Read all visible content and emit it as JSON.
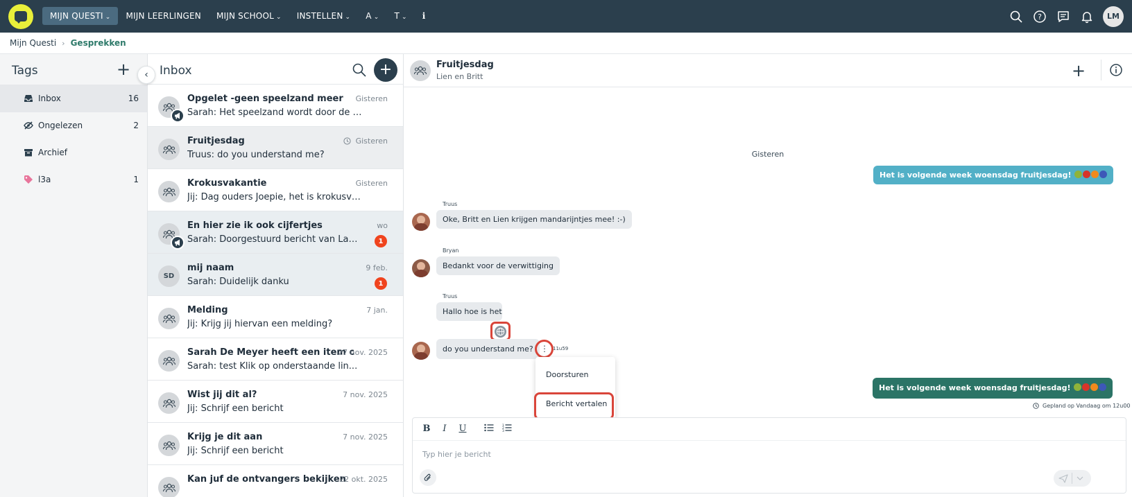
{
  "nav": {
    "items": [
      {
        "label": "MIJN QUESTI",
        "dropdown": true,
        "active": true
      },
      {
        "label": "MIJN LEERLINGEN",
        "dropdown": false,
        "active": false
      },
      {
        "label": "MIJN SCHOOL",
        "dropdown": true,
        "active": false
      },
      {
        "label": "INSTELLEN",
        "dropdown": true,
        "active": false
      },
      {
        "label": "A",
        "dropdown": true,
        "active": false
      },
      {
        "label": "T",
        "dropdown": true,
        "active": false
      }
    ],
    "user_initials": "LM"
  },
  "breadcrumb": {
    "home": "Mijn Questi",
    "current": "Gesprekken"
  },
  "tags": {
    "title": "Tags",
    "items": [
      {
        "label": "Inbox",
        "count": "16",
        "icon": "inbox-icon",
        "active": true
      },
      {
        "label": "Ongelezen",
        "count": "2",
        "icon": "eye-off-icon",
        "active": false
      },
      {
        "label": "Archief",
        "count": "",
        "icon": "archive-icon",
        "active": false
      },
      {
        "label": "l3a",
        "count": "1",
        "icon": "tag-icon",
        "active": false,
        "color": "#e8759b"
      }
    ]
  },
  "inbox": {
    "title": "Inbox",
    "conversations": [
      {
        "title": "Opgelet -geen speelzand meer",
        "snippet": "Sarah: Het speelzand wordt door de ge...",
        "date": "Gisteren",
        "badge": "",
        "avatar": "group",
        "announcement": true,
        "state": "normal",
        "clock": false
      },
      {
        "title": "Fruitjesdag",
        "snippet": "Truus: do you understand me?",
        "date": "Gisteren",
        "badge": "",
        "avatar": "group",
        "announcement": false,
        "state": "selected",
        "clock": true
      },
      {
        "title": "Krokusvakantie",
        "snippet": "Jij: Dag ouders Joepie, het is krokusvak...",
        "date": "Gisteren",
        "badge": "",
        "avatar": "group",
        "announcement": false,
        "state": "normal",
        "clock": false
      },
      {
        "title": "En hier zie ik ook cijfertjes",
        "snippet": "Sarah: Doorgestuurd bericht van Las Timm...",
        "date": "wo",
        "badge": "1",
        "avatar": "group",
        "announcement": true,
        "state": "unread",
        "clock": false
      },
      {
        "title": "mij naam",
        "snippet": "Sarah: Duidelijk danku",
        "date": "9 feb.",
        "badge": "1",
        "avatar": "SD",
        "announcement": false,
        "state": "unread",
        "clock": false
      },
      {
        "title": "Melding",
        "snippet": "Jij: Krijg jij hiervan een melding?",
        "date": "7 jan.",
        "badge": "",
        "avatar": "group",
        "announcement": false,
        "state": "normal",
        "clock": false
      },
      {
        "title": "Sarah De Meyer heeft een item over...",
        "snippet": "Sarah: test Klik op onderstaande lin...",
        "date": "27 nov. 2025",
        "badge": "",
        "avatar": "group",
        "announcement": false,
        "state": "normal",
        "clock": false
      },
      {
        "title": "Wist jij dit al?",
        "snippet": "Jij: Schrijf een bericht",
        "date": "7 nov. 2025",
        "badge": "",
        "avatar": "group",
        "announcement": false,
        "state": "normal",
        "clock": false
      },
      {
        "title": "Krijg je dit aan",
        "snippet": "Jij: Schrijf een bericht",
        "date": "7 nov. 2025",
        "badge": "",
        "avatar": "group",
        "announcement": false,
        "state": "normal",
        "clock": false
      },
      {
        "title": "Kan juf de ontvangers bekijken",
        "snippet": "",
        "date": "22 okt. 2025",
        "badge": "",
        "avatar": "group",
        "announcement": false,
        "state": "normal",
        "clock": false
      }
    ]
  },
  "chat": {
    "title": "Fruitjesdag",
    "subtitle": "Lien en Britt",
    "day_separator": "Gisteren",
    "messages": [
      {
        "direction": "out",
        "text": "Het is volgende week woensdag fruitjesdag! ",
        "scheduled": false
      },
      {
        "direction": "in",
        "sender": "Truus",
        "text": "Oke, Britt en Lien krijgen mandarijntjes mee! :-)"
      },
      {
        "direction": "in",
        "sender": "Bryan",
        "text": "Bedankt voor de verwittiging"
      },
      {
        "direction": "in",
        "sender": "Truus",
        "text": "Hallo hoe is het"
      },
      {
        "direction": "in",
        "sender": "",
        "text": "do you understand me?",
        "time": "11u59"
      },
      {
        "direction": "out",
        "text": "Het is volgende week woensdag fruitjesdag! ",
        "scheduled": true
      }
    ],
    "context_menu": [
      "Doorsturen",
      "Bericht vertalen"
    ],
    "scheduled_note": "Gepland op Vandaag om 12u00",
    "composer_placeholder": "Typ hier je bericht",
    "colors": {
      "outgoing": "#52b0c7",
      "scheduled": "#2b7466",
      "highlight": "#d9453a",
      "badge": "#f0441e",
      "topbar": "#2b3f4d",
      "logo": "#e9ef3a"
    }
  }
}
